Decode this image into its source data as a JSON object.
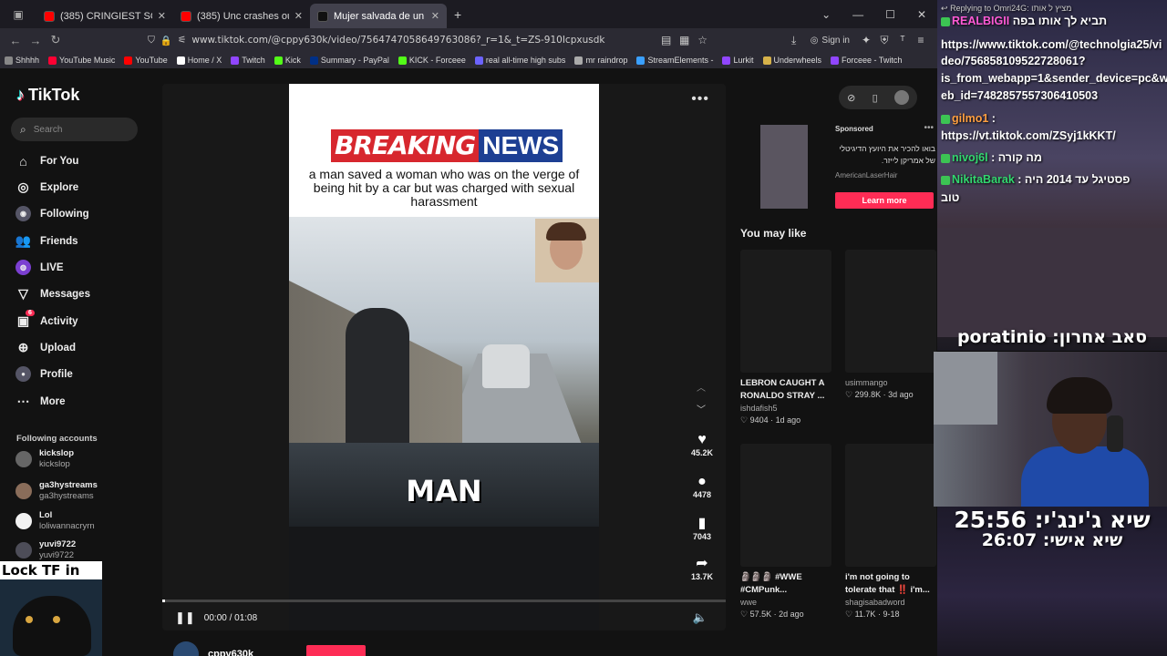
{
  "browser": {
    "tabs": [
      {
        "label": "(385) CRINGIEST SCHOOL MOM",
        "color": "#ff0000",
        "active": false
      },
      {
        "label": "(385) Unc crashes out for buzzb",
        "color": "#ff0000",
        "active": false
      },
      {
        "label": "Mujer salvada de un accidente",
        "color": "#111111",
        "active": true
      }
    ],
    "new_tab": "+",
    "url": "www.tiktok.com/@cppy630k/video/7564747058649763086?_r=1&_t=ZS-910Icpxusdk",
    "sign_in": "Sign in",
    "bookmarks": [
      {
        "label": "Shhhh",
        "color": "#888888"
      },
      {
        "label": "YouTube Music",
        "color": "#ff0033"
      },
      {
        "label": "YouTube",
        "color": "#ff0000"
      },
      {
        "label": "Home / X",
        "color": "#ffffff"
      },
      {
        "label": "Twitch",
        "color": "#9146ff"
      },
      {
        "label": "Kick",
        "color": "#53fc18"
      },
      {
        "label": "Summary - PayPal",
        "color": "#003087"
      },
      {
        "label": "KICK - Forceee",
        "color": "#53fc18"
      },
      {
        "label": "real all-time high subs",
        "color": "#6c63ff"
      },
      {
        "label": "mr raindrop",
        "color": "#aaaaaa"
      },
      {
        "label": "StreamElements -",
        "color": "#3aa0ff"
      },
      {
        "label": "Lurkit",
        "color": "#9146ff"
      },
      {
        "label": "Underwheels",
        "color": "#d6b24a"
      },
      {
        "label": "Forceee - Twitch",
        "color": "#9146ff"
      }
    ]
  },
  "tiktok": {
    "logo": "TikTok",
    "search_placeholder": "Search",
    "nav": [
      "For You",
      "Explore",
      "Following",
      "Friends",
      "LIVE",
      "Messages",
      "Activity",
      "Upload",
      "Profile",
      "More"
    ],
    "activity_badge": "6",
    "following_title": "Following accounts",
    "accounts": [
      {
        "name": "kickslop",
        "handle": "kickslop"
      },
      {
        "name": "ga3hystreams",
        "handle": "ga3hystreams"
      },
      {
        "name": "Lol",
        "handle": "loliwannacryrn"
      },
      {
        "name": "yuvi9722",
        "handle": "yuvi9722"
      }
    ],
    "lock_text": "Lock TF in",
    "video": {
      "breaking": "BREAKING",
      "news": "NEWS",
      "headline": "a man saved a woman who was on the verge of being hit by a car but was charged with sexual harassment",
      "caption_word": "MAN",
      "time": "00:00 / 01:08",
      "progress": 0.005
    },
    "actions": [
      {
        "icon": "heart-icon",
        "glyph": "♥",
        "count": "45.2K"
      },
      {
        "icon": "comment-icon",
        "glyph": "●",
        "count": "4478"
      },
      {
        "icon": "bookmark-icon",
        "glyph": "▮",
        "count": "7043"
      },
      {
        "icon": "share-icon",
        "glyph": "➦",
        "count": "13.7K"
      }
    ],
    "author": "cppy630k",
    "ad": {
      "sponsored": "Sponsored",
      "text": "בואו להכיר את היועץ הדיגיטלי של אמריקן לייזר.",
      "brand": "AmericanLaserHair",
      "button": "Learn more"
    },
    "you_may_like": "You may like",
    "cards": [
      {
        "title": "LEBRON CAUGHT A RONALDO STRAY ...",
        "author": "ishdafish5",
        "views": "9404",
        "ago": "1d ago"
      },
      {
        "title": "",
        "author": "usimmango",
        "views": "299.8K",
        "ago": "3d ago"
      },
      {
        "title": "🗿🗿🗿 #WWE #CMPunk...",
        "author": "wwe",
        "views": "57.5K",
        "ago": "2d ago"
      },
      {
        "title": "i'm not going to tolerate that ‼️ i'm...",
        "author": "shagisabadword",
        "views": "11.7K",
        "ago": "9-18"
      }
    ]
  },
  "stream": {
    "reply_line": "Replying to Omri24G: מציץ ל אותו",
    "chat": [
      {
        "user": "REALBIGII",
        "text": "תביא לך אותו בפה",
        "color": "#ff5ad6"
      },
      {
        "user": "",
        "text": "https://www.tiktok.com/@technolgia25/vi",
        "color": "#ffffff"
      },
      {
        "user": "",
        "text": "deo/756858109522728061​?",
        "color": "#ffffff"
      },
      {
        "user": "",
        "text": "is_from_webapp=1&sender_device=pc&w",
        "color": "#ffffff"
      },
      {
        "user": "",
        "text": "eb_id=7482857557306410503",
        "color": "#ffffff"
      },
      {
        "user": "gilmo1",
        "text": ":",
        "color": "#ff9f40"
      },
      {
        "user": "",
        "text": "https://vt.tiktok.com/ZSyj1kKKT/",
        "color": "#ffffff"
      },
      {
        "user": "nivoj6l",
        "text": ": מה קורה",
        "color": "#32d86f"
      },
      {
        "user": "NikitaBarak",
        "text": ": פסטיגל עד 2014 היה",
        "color": "#32d86f"
      },
      {
        "user": "",
        "text": "טוב",
        "color": "#ffffff"
      }
    ],
    "caption": "סאב אחרון: poratinio",
    "timer1": "שיא ג'ינג'י: 25:56",
    "timer2": "שיא אישי: 26:07"
  }
}
